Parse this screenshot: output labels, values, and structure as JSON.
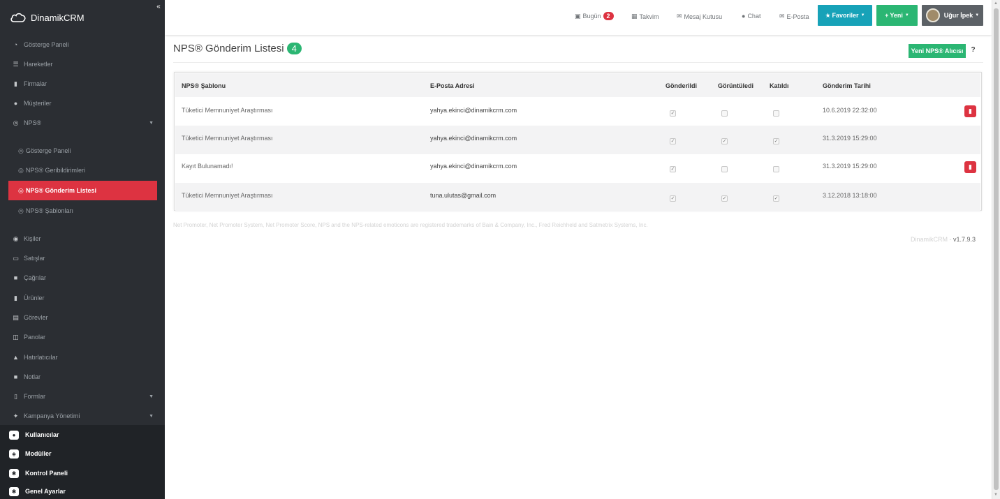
{
  "brand": {
    "name": "DinamikCRM"
  },
  "sidebar": {
    "collapse_icon": "«",
    "items": [
      {
        "label": "Gösterge Paneli",
        "icon": "dashboard-icon"
      },
      {
        "label": "Hareketler",
        "icon": "list-icon"
      },
      {
        "label": "Firmalar",
        "icon": "building-icon"
      },
      {
        "label": "Müşteriler",
        "icon": "users-icon"
      },
      {
        "label": "NPS®",
        "icon": "target-icon"
      }
    ],
    "nps_sub": [
      {
        "label": "Gösterge Paneli"
      },
      {
        "label": "NPS® Geribildirimleri"
      },
      {
        "label": "NPS® Gönderim Listesi",
        "active": true
      },
      {
        "label": "NPS® Şablonları"
      }
    ],
    "items2": [
      {
        "label": "Kişiler",
        "icon": "person-icon"
      },
      {
        "label": "Satışlar",
        "icon": "money-icon"
      },
      {
        "label": "Çağrılar",
        "icon": "phone-icon"
      },
      {
        "label": "Ürünler",
        "icon": "box-icon"
      },
      {
        "label": "Görevler",
        "icon": "tasks-icon"
      },
      {
        "label": "Panolar",
        "icon": "board-icon"
      },
      {
        "label": "Hatırlatıcılar",
        "icon": "bell-icon"
      },
      {
        "label": "Notlar",
        "icon": "note-icon"
      },
      {
        "label": "Formlar",
        "icon": "file-icon"
      },
      {
        "label": "Kampanya Yönetimi",
        "icon": "bullhorn-icon"
      }
    ],
    "bottom": [
      {
        "label": "Kullanıcılar",
        "icon": "user-icon"
      },
      {
        "label": "Modüller",
        "icon": "cube-icon"
      },
      {
        "label": "Kontrol Paneli",
        "icon": "cog-icon"
      },
      {
        "label": "Genel Ayarlar",
        "icon": "settings-icon"
      }
    ]
  },
  "topbar": {
    "today_label": "Bugün",
    "today_count": "2",
    "calendar_label": "Takvim",
    "inbox_label": "Mesaj Kutusu",
    "chat_label": "Chat",
    "email_label": "E-Posta",
    "favorites_label": "Favoriler",
    "new_label": "Yeni",
    "user_name": "Uğur İpek",
    "colors": {
      "favorites": "#17a2b8",
      "new": "#2bb673",
      "user": "#5c6166"
    }
  },
  "page": {
    "title": "NPS® Gönderim Listesi",
    "count": "4",
    "new_button": "Yeni NPS® Alıcısı",
    "help": "?"
  },
  "table": {
    "headers": [
      "NPS® Şablonu",
      "E-Posta Adresi",
      "Gönderildi",
      "Görüntüledi",
      "Katıldı",
      "Gönderim Tarihi"
    ],
    "rows": [
      {
        "template": "Tüketici Memnuniyet Araştırması",
        "email": "yahya.ekinci@dinamikcrm.com",
        "sent": true,
        "viewed": false,
        "joined": false,
        "date": "10.6.2019 22:32:00",
        "deletable": true
      },
      {
        "template": "Tüketici Memnuniyet Araştırması",
        "email": "yahya.ekinci@dinamikcrm.com",
        "sent": true,
        "viewed": true,
        "joined": true,
        "date": "31.3.2019 15:29:00",
        "deletable": false
      },
      {
        "template": "Kayıt Bulunamadı!",
        "email": "yahya.ekinci@dinamikcrm.com",
        "sent": true,
        "viewed": false,
        "joined": false,
        "date": "31.3.2019 15:29:00",
        "deletable": true
      },
      {
        "template": "Tüketici Memnuniyet Araştırması",
        "email": "tuna.ulutas@gmail.com",
        "sent": true,
        "viewed": true,
        "joined": true,
        "date": "3.12.2018 13:18:00",
        "deletable": false
      }
    ]
  },
  "footer": {
    "note": "Net Promoter, Net Promoter System, Net Promoter Score, NPS and the NPS-related emoticons are registered trademarks of Bain & Company, Inc., Fred Reichheld and Satmetrix Systems, Inc.",
    "app": "DinamikCRM",
    "separator": " - ",
    "version": "v1.7.9.3"
  }
}
